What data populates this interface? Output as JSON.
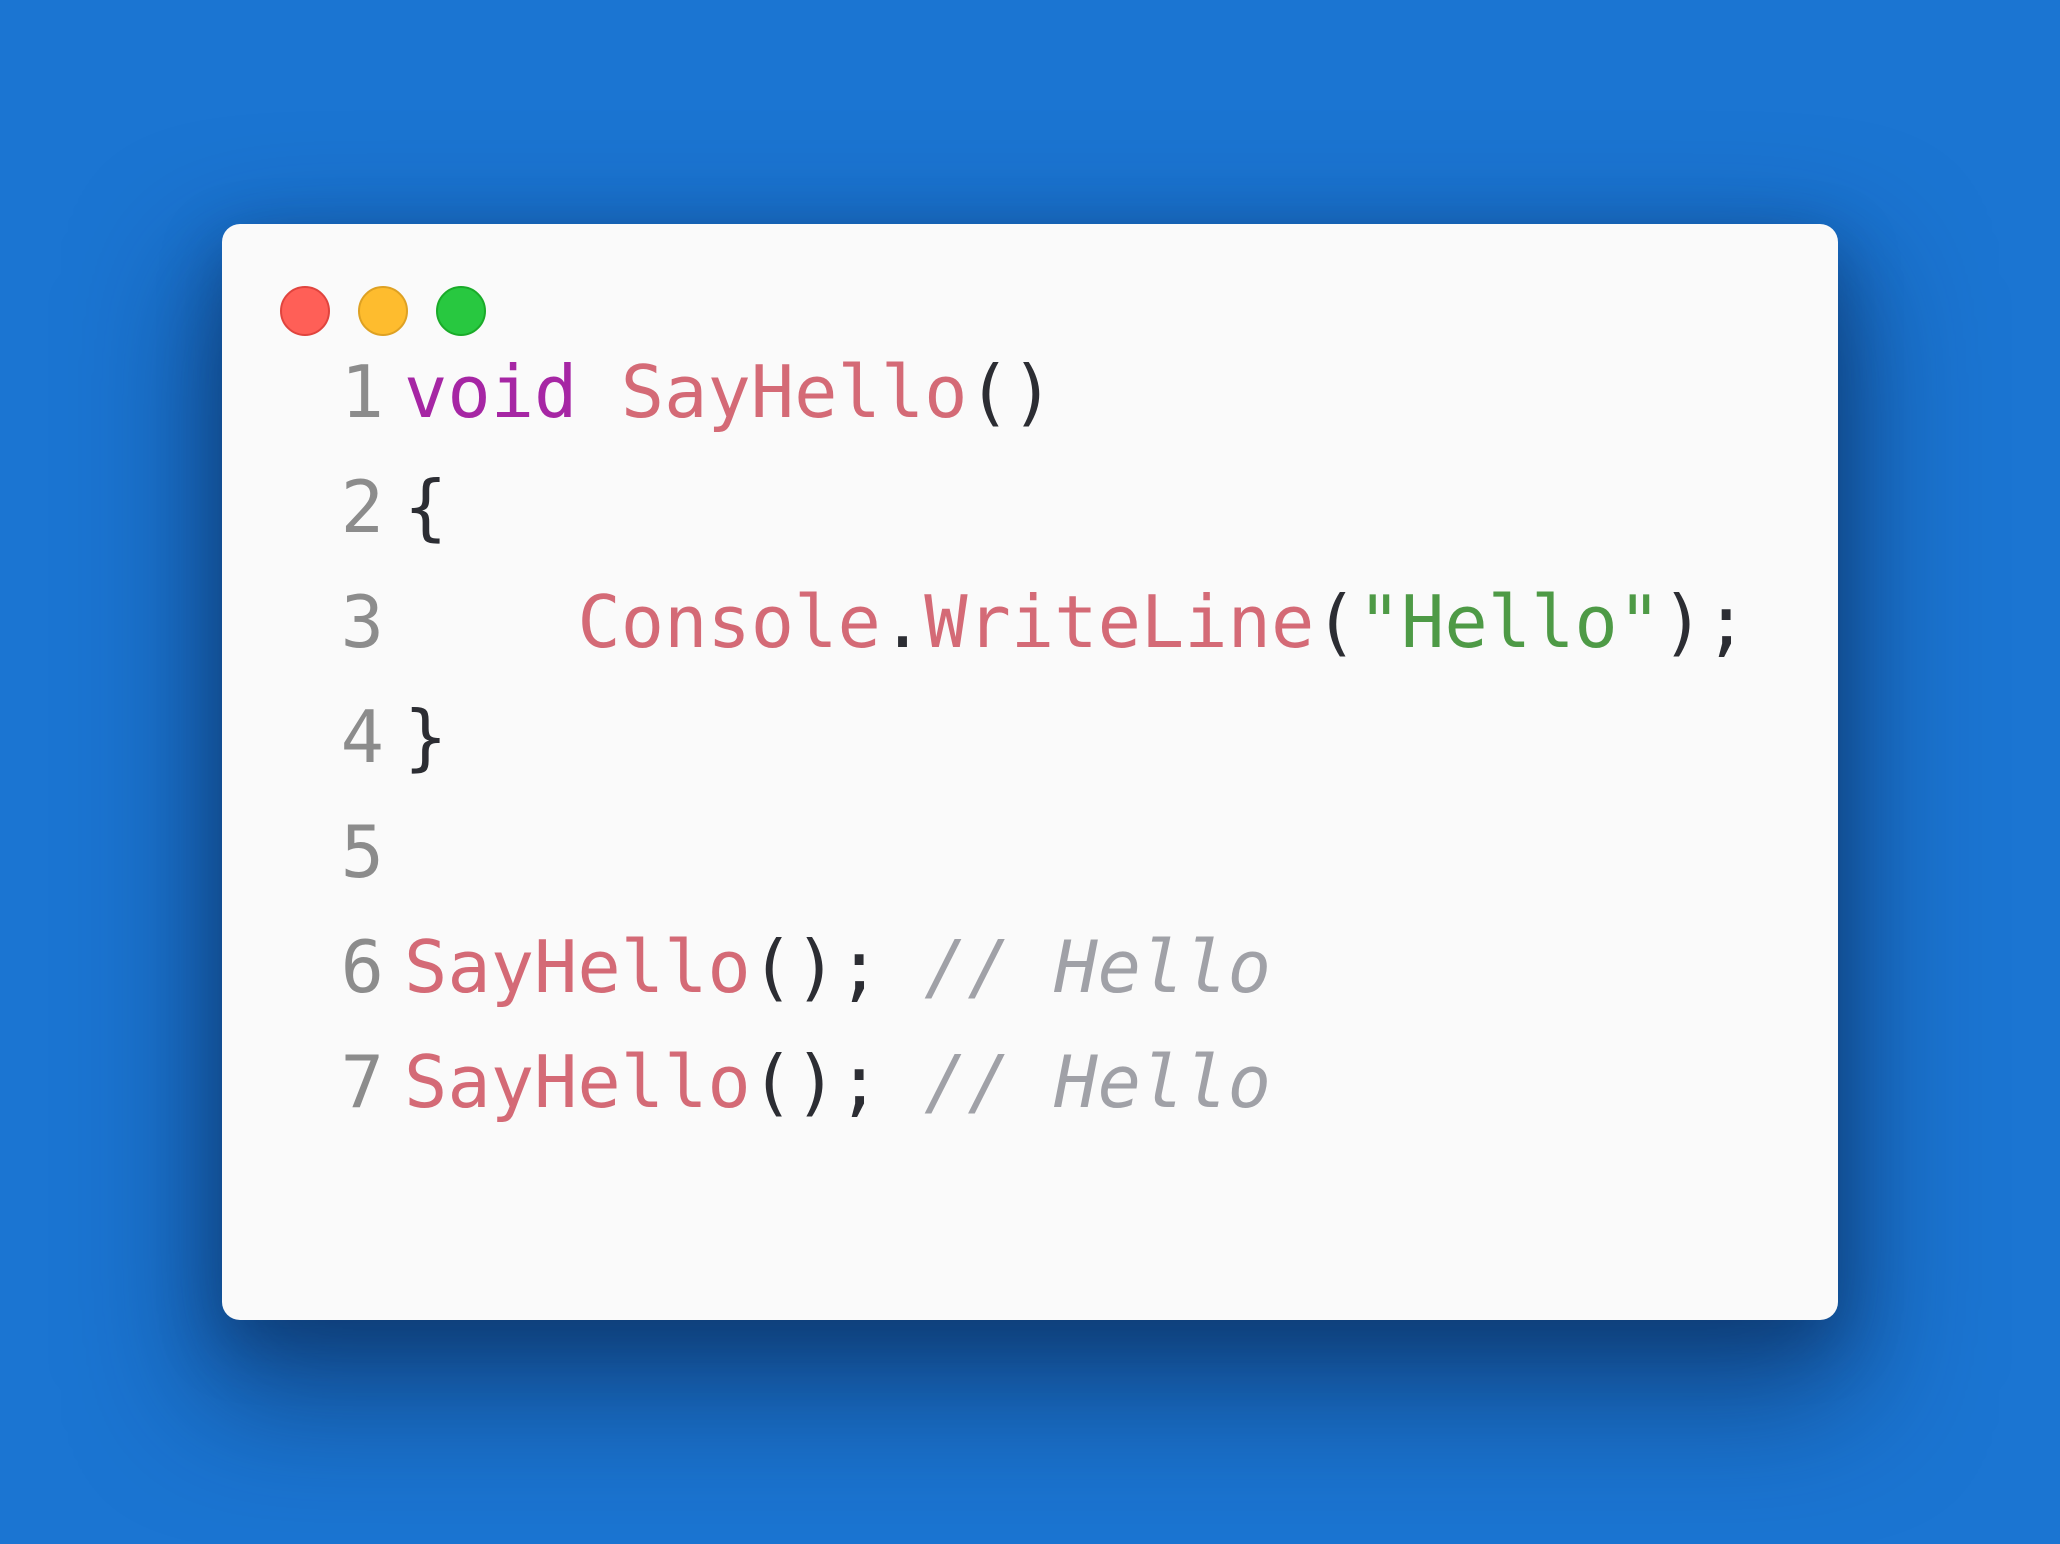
{
  "background_color": "#1b75d2",
  "window": {
    "controls": [
      "close",
      "minimize",
      "maximize"
    ],
    "control_colors": {
      "close": "#ff5f57",
      "minimize": "#febc2e",
      "maximize": "#28c840"
    }
  },
  "code": {
    "language": "csharp",
    "lines": [
      {
        "number": "1",
        "tokens": [
          {
            "t": "void",
            "k": "kw"
          },
          {
            "t": " ",
            "k": "pun"
          },
          {
            "t": "SayHello",
            "k": "fn"
          },
          {
            "t": "()",
            "k": "pun"
          }
        ]
      },
      {
        "number": "2",
        "tokens": [
          {
            "t": "{",
            "k": "pun"
          }
        ]
      },
      {
        "number": "3",
        "tokens": [
          {
            "t": "    ",
            "k": "pun"
          },
          {
            "t": "Console",
            "k": "fn"
          },
          {
            "t": ".",
            "k": "pun"
          },
          {
            "t": "WriteLine",
            "k": "fn"
          },
          {
            "t": "(",
            "k": "pun"
          },
          {
            "t": "\"Hello\"",
            "k": "str"
          },
          {
            "t": ");",
            "k": "pun"
          }
        ]
      },
      {
        "number": "4",
        "tokens": [
          {
            "t": "}",
            "k": "pun"
          }
        ]
      },
      {
        "number": "5",
        "tokens": []
      },
      {
        "number": "6",
        "tokens": [
          {
            "t": "SayHello",
            "k": "fn"
          },
          {
            "t": "(); ",
            "k": "pun"
          },
          {
            "t": "// Hello",
            "k": "cm"
          }
        ]
      },
      {
        "number": "7",
        "tokens": [
          {
            "t": "SayHello",
            "k": "fn"
          },
          {
            "t": "(); ",
            "k": "pun"
          },
          {
            "t": "// Hello",
            "k": "cm"
          }
        ]
      }
    ]
  }
}
